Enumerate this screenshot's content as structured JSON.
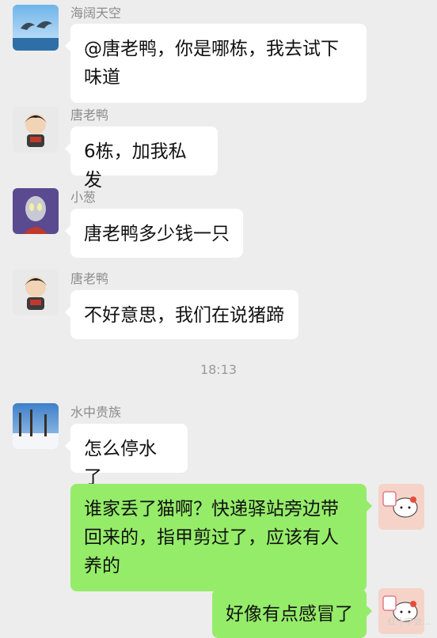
{
  "messages": [
    {
      "name": "海阔天空",
      "text": "@唐老鸭，你是哪栋，我去试下味道",
      "avatar": "dolphin-avatar"
    },
    {
      "name": "唐老鸭",
      "text": "6栋，加我私发",
      "avatar": "boy-figure-avatar"
    },
    {
      "name": "小葱",
      "text": "唐老鸭多少钱一只",
      "avatar": "ultraman-avatar"
    },
    {
      "name": "唐老鸭",
      "text": "不好意思，我们在说猪蹄",
      "avatar": "boy-figure-avatar"
    },
    {
      "time": "18:13"
    },
    {
      "name": "水中贵族",
      "text": "怎么停水了",
      "avatar": "snow-forest-avatar"
    },
    {
      "text": "谁家丢了猫啊？快递驿站旁边带回来的，指甲剪过了，应该有人养的",
      "avatar": "hello-kitty-avatar",
      "self": true
    },
    {
      "text": "好像有点感冒了",
      "avatar": "hello-kitty-avatar",
      "self": true
    }
  ],
  "colors": {
    "background": "#ededed",
    "incoming": "#ffffff",
    "outgoing": "#95ec69"
  },
  "watermark": "红十字会..."
}
